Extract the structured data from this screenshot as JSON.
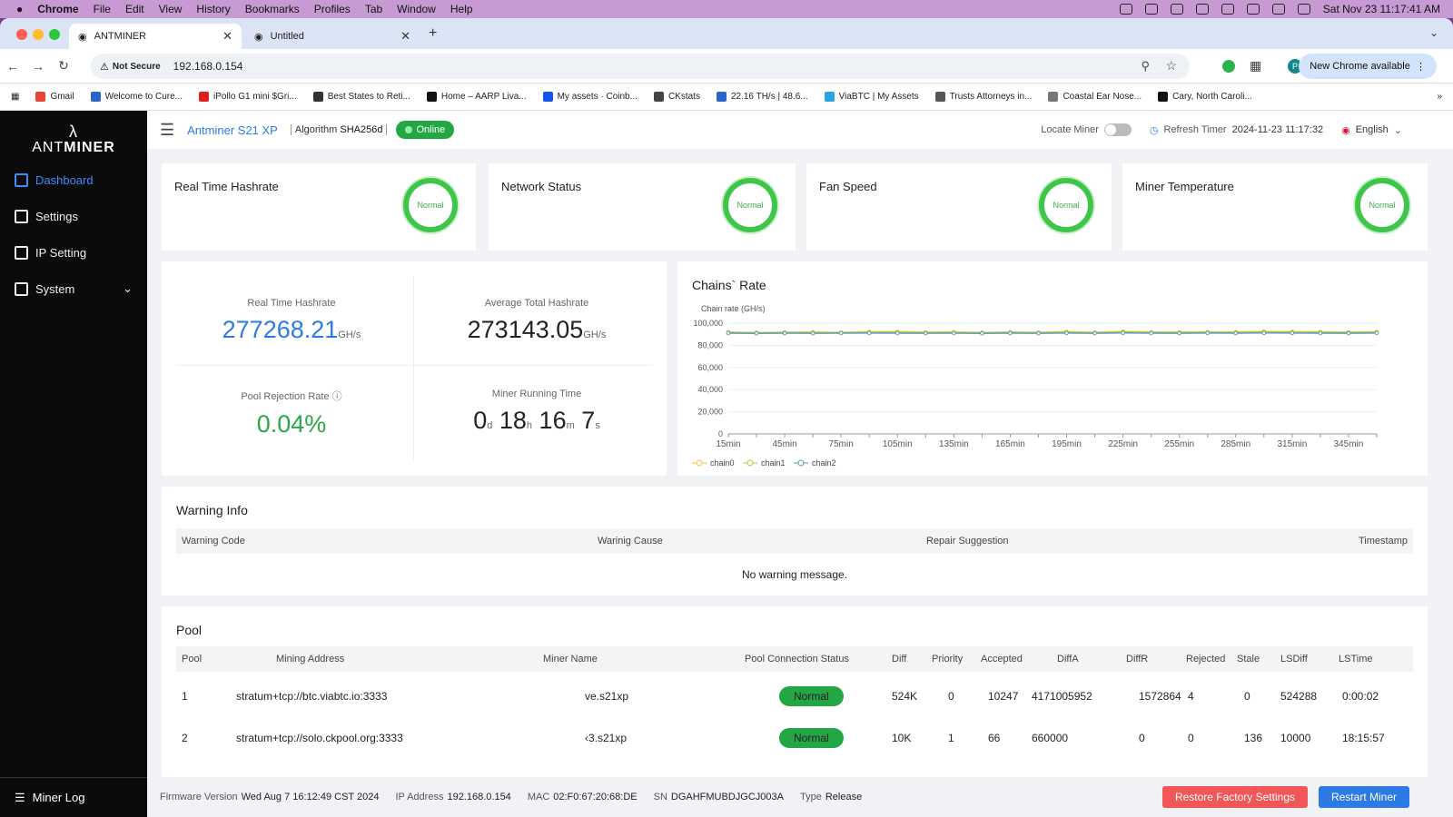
{
  "macbar": {
    "app": "Chrome",
    "menus": [
      "File",
      "Edit",
      "View",
      "History",
      "Bookmarks",
      "Profiles",
      "Tab",
      "Window",
      "Help"
    ],
    "clock": "Sat Nov 23  11:17:41 AM"
  },
  "tabs": [
    {
      "title": "ANTMINER"
    },
    {
      "title": "Untitled"
    }
  ],
  "url": {
    "security": "Not Secure",
    "address": "192.168.0.154",
    "new_chrome": "New Chrome available"
  },
  "bookmarks": [
    {
      "label": "Gmail",
      "color": "#ea4335"
    },
    {
      "label": "Welcome to Cure...",
      "color": "#2a66c8"
    },
    {
      "label": "iPollo G1 mini $Gri...",
      "color": "#e02020"
    },
    {
      "label": "Best States to Reti...",
      "color": "#333"
    },
    {
      "label": "Home – AARP Liva...",
      "color": "#111"
    },
    {
      "label": "My assets · Coinb...",
      "color": "#1652f0"
    },
    {
      "label": "CKstats",
      "color": "#444"
    },
    {
      "label": "22.16 TH/s | 48.6...",
      "color": "#2a66c8"
    },
    {
      "label": "ViaBTC | My Assets",
      "color": "#2aa4e0"
    },
    {
      "label": "Trusts Attorneys in...",
      "color": "#555"
    },
    {
      "label": "Coastal Ear Nose...",
      "color": "#777"
    },
    {
      "label": "Cary, North Caroli...",
      "color": "#111"
    }
  ],
  "sidebar": {
    "brand_a": "ANT",
    "brand_b": "MINER",
    "items": [
      {
        "label": "Dashboard"
      },
      {
        "label": "Settings"
      },
      {
        "label": "IP Setting"
      },
      {
        "label": "System"
      }
    ],
    "log": "Miner Log"
  },
  "topbar": {
    "miner": "Antminer S21 XP",
    "algo_label": "Algorithm",
    "algo": "SHA256d",
    "status": "Online",
    "locate": "Locate Miner",
    "refresh_label": "Refresh Timer",
    "refresh_time": "2024-11-23 11:17:32",
    "lang": "English"
  },
  "stats": [
    {
      "label": "Real Time Hashrate",
      "state": "Normal"
    },
    {
      "label": "Network Status",
      "state": "Normal"
    },
    {
      "label": "Fan Speed",
      "state": "Normal"
    },
    {
      "label": "Miner Temperature",
      "state": "Normal"
    }
  ],
  "metrics": {
    "rt_label": "Real Time Hashrate",
    "rt_value": "277268.21",
    "rt_unit": "GH/s",
    "avg_label": "Average Total Hashrate",
    "avg_value": "273143.05",
    "avg_unit": "GH/s",
    "rej_label": "Pool Rejection Rate",
    "rej_value": "0.04%",
    "run_label": "Miner Running Time",
    "run_d": "0",
    "run_h": "18",
    "run_m": "16",
    "run_s": "7"
  },
  "chart_data": {
    "type": "line",
    "title": "Chains` Rate",
    "ylabel": "Chain rate (GH/s)",
    "ylim": [
      0,
      100000
    ],
    "yticks": [
      "0",
      "20,000",
      "40,000",
      "60,000",
      "80,000",
      "100,000"
    ],
    "x": [
      "15min",
      "30min",
      "45min",
      "60min",
      "75min",
      "90min",
      "105min",
      "120min",
      "135min",
      "150min",
      "165min",
      "180min",
      "195min",
      "210min",
      "225min",
      "240min",
      "255min",
      "270min",
      "285min",
      "300min",
      "315min",
      "330min",
      "345min",
      "360min"
    ],
    "xtick_labels": [
      "15min",
      "45min",
      "75min",
      "105min",
      "135min",
      "165min",
      "195min",
      "225min",
      "255min",
      "285min",
      "315min",
      "345min"
    ],
    "series": [
      {
        "name": "chain0",
        "color": "#f5c842",
        "values": [
          92000,
          91500,
          91800,
          92000,
          91700,
          92200,
          92400,
          91900,
          92100,
          91600,
          92000,
          91800,
          92300,
          91700,
          92500,
          92000,
          91900,
          92100,
          92000,
          92600,
          92300,
          92100,
          91900,
          92200
        ]
      },
      {
        "name": "chain1",
        "color": "#b8c83a",
        "values": [
          91500,
          91200,
          91600,
          91400,
          91300,
          91800,
          91700,
          91400,
          91500,
          91200,
          91700,
          91300,
          91900,
          91200,
          92000,
          91600,
          91500,
          91700,
          91600,
          91900,
          91800,
          91700,
          91500,
          91800
        ]
      },
      {
        "name": "chain2",
        "color": "#5aa0b8",
        "values": [
          91000,
          90800,
          91000,
          90900,
          91000,
          91100,
          91000,
          90900,
          91000,
          90800,
          91000,
          90900,
          91100,
          90900,
          91200,
          91000,
          90900,
          91100,
          91000,
          91200,
          91100,
          91000,
          90900,
          91100
        ]
      }
    ]
  },
  "warning": {
    "title": "Warning Info",
    "cols": [
      "Warning Code",
      "Warinig Cause",
      "Repair Suggestion",
      "Timestamp"
    ],
    "empty": "No warning message."
  },
  "pool": {
    "title": "Pool",
    "cols": [
      "Pool",
      "Mining Address",
      "Miner Name",
      "Pool Connection Status",
      "Diff",
      "Priority",
      "Accepted",
      "DiffA",
      "DiffR",
      "Rejected",
      "Stale",
      "LSDiff",
      "LSTime"
    ],
    "rows": [
      [
        "1",
        "stratum+tcp://btc.viabtc.io:3333",
        "ve.s21xp",
        "Normal",
        "524K",
        "0",
        "10247",
        "4171005952",
        "1572864",
        "4",
        "0",
        "524288",
        "0:00:02"
      ],
      [
        "2",
        "stratum+tcp://solo.ckpool.org:3333",
        "‹3.s21xp",
        "Normal",
        "10K",
        "1",
        "66",
        "660000",
        "0",
        "0",
        "136",
        "10000",
        "18:15:57"
      ]
    ]
  },
  "footer": {
    "fw_label": "Firmware Version",
    "fw": "Wed Aug 7 16:12:49 CST 2024",
    "ip_label": "IP Address",
    "ip": "192.168.0.154",
    "mac_label": "MAC",
    "mac": "02:F0:67:20:68:DE",
    "sn_label": "SN",
    "sn": "DGAHFMUBDJGCJ003A",
    "type_label": "Type",
    "type": "Release",
    "restore": "Restore Factory Settings",
    "restart": "Restart Miner"
  }
}
